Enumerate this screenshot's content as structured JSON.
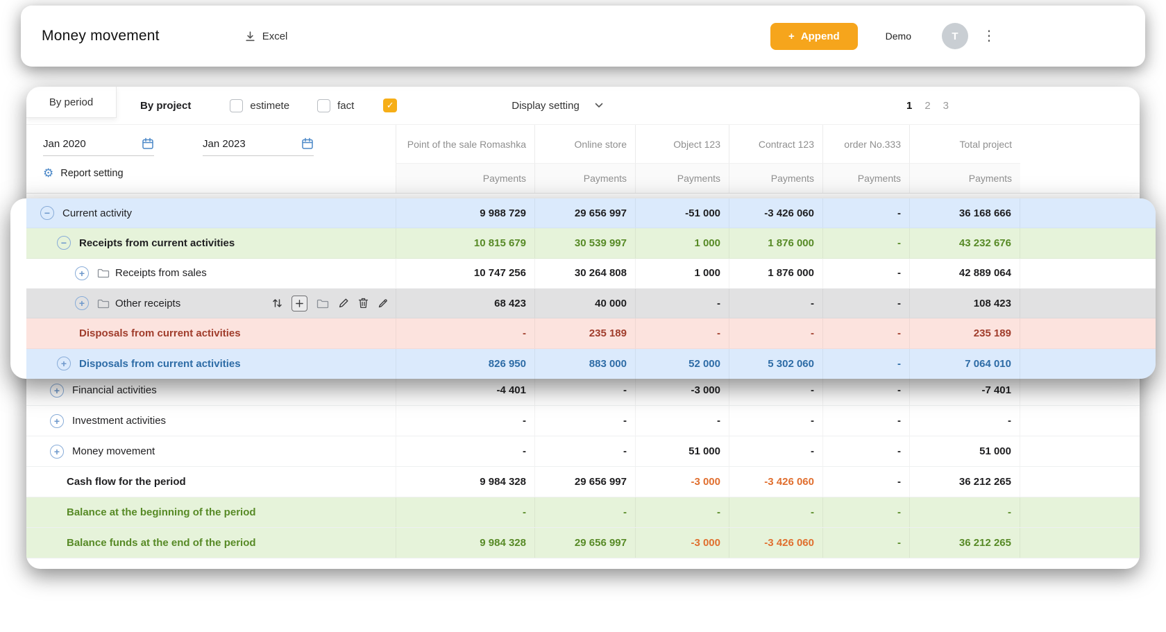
{
  "colors": {
    "accent_orange": "#f6a51c",
    "green_text": "#578a26",
    "blue_text": "#2e6ca6",
    "red_text": "#a03d2c",
    "orange_text": "#e06f2f",
    "default_text": "#1f1f21",
    "blue_row_bg": "#dbeafc",
    "green_row_bg": "#e6f3da",
    "gray_row_bg": "#e1e1e2",
    "pink_row_bg": "#fce3de"
  },
  "header": {
    "title": "Money movement",
    "excel_label": "Excel",
    "append_plus": "+",
    "append_label": "Append",
    "demo_label": "Demo",
    "avatar_initial": "T"
  },
  "toolbar": {
    "tab_by_period": "By period",
    "tab_by_project": "By project",
    "checkbox_estimete": "estimete",
    "checkbox_fact": "fact",
    "display_setting": "Display setting",
    "pagination": {
      "pages": [
        "1",
        "2",
        "3"
      ],
      "active": "1"
    }
  },
  "filters": {
    "date_from": "Jan 2020",
    "date_to": "Jan 2023",
    "report_setting": "Report setting"
  },
  "table": {
    "columns": [
      "Point of the sale Romashka",
      "Online store",
      "Object 123",
      "Contract 123",
      "order No.333",
      "Total project"
    ],
    "payments_label": "Payments",
    "row_actions": [
      "sort-icon",
      "add-icon",
      "folder-icon",
      "pencil-icon",
      "trash-icon",
      "pen-icon"
    ],
    "strip_rows": [
      {
        "label": "Current activity",
        "level": 1,
        "expand": "minus",
        "bg": "blue",
        "tone": "default",
        "values": [
          "9 988 729",
          "29 656 997",
          "-51 000",
          "-3 426 060",
          "-",
          "36 168 666"
        ]
      },
      {
        "label": "Receipts from current activities",
        "level": 2,
        "expand": "minus",
        "bg": "green",
        "label_bold": true,
        "tone": "green",
        "values": [
          "10 815 679",
          "30 539 997",
          "1 000",
          "1 876 000",
          "-",
          "43 232 676"
        ]
      },
      {
        "label": "Receipts from sales",
        "level": 3,
        "expand": "plus",
        "folder": true,
        "tone": "default",
        "values": [
          "10 747 256",
          "30 264 808",
          "1 000",
          "1 876 000",
          "-",
          "42 889 064"
        ]
      },
      {
        "label": "Other receipts",
        "level": 3,
        "expand": "plus",
        "folder": true,
        "bg": "gray",
        "actions": true,
        "tone": "default",
        "values": [
          "68 423",
          "40 000",
          "-",
          "-",
          "-",
          "108 423"
        ]
      },
      {
        "label": "Disposals from current activities",
        "level": 2,
        "bg": "pink",
        "label_bold": true,
        "label_tone": "red",
        "tone": "red",
        "values": [
          "-",
          "235 189",
          "-",
          "-",
          "-",
          "235 189"
        ]
      },
      {
        "label": "Disposals from current activities",
        "level": 2,
        "expand": "plus",
        "bg": "blue",
        "label_bold": true,
        "label_tone": "blue",
        "tone": "blue",
        "values": [
          "826 950",
          "883 000",
          "52 000",
          "5 302 060",
          "-",
          "7 064 010"
        ]
      }
    ],
    "main_rows": [
      {
        "label": "Financial activities",
        "level": 1,
        "expand": "plus",
        "tone": "default",
        "values": [
          "-4 401",
          "-",
          "-3 000",
          "-",
          "-",
          "-7 401"
        ]
      },
      {
        "label": "Investment activities",
        "level": 1,
        "expand": "plus",
        "tone": "default",
        "values": [
          "-",
          "-",
          "-",
          "-",
          "-",
          "-"
        ]
      },
      {
        "label": "Money movement",
        "level": 1,
        "expand": "plus",
        "tone": "default",
        "values": [
          "-",
          "-",
          "51 000",
          "-",
          "-",
          "51 000"
        ]
      },
      {
        "label": "Cash flow for the period",
        "level": 0,
        "label_bold": true,
        "tone": "default",
        "cell_tones": {
          "2": "orange",
          "3": "orange"
        },
        "values": [
          "9 984 328",
          "29 656 997",
          "-3 000",
          "-3 426 060",
          "-",
          "36 212 265"
        ]
      },
      {
        "label": "Balance at the beginning of the period",
        "level": 0,
        "label_bold": true,
        "label_tone": "green",
        "bg": "green",
        "tone": "green",
        "values": [
          "-",
          "-",
          "-",
          "-",
          "-",
          "-"
        ]
      },
      {
        "label": "Balance funds at the end of the period",
        "level": 0,
        "label_bold": true,
        "label_tone": "green",
        "bg": "green",
        "tone": "green",
        "cell_tones": {
          "2": "orange",
          "3": "orange"
        },
        "values": [
          "9 984 328",
          "29 656 997",
          "-3 000",
          "-3 426 060",
          "-",
          "36 212 265"
        ]
      }
    ]
  }
}
